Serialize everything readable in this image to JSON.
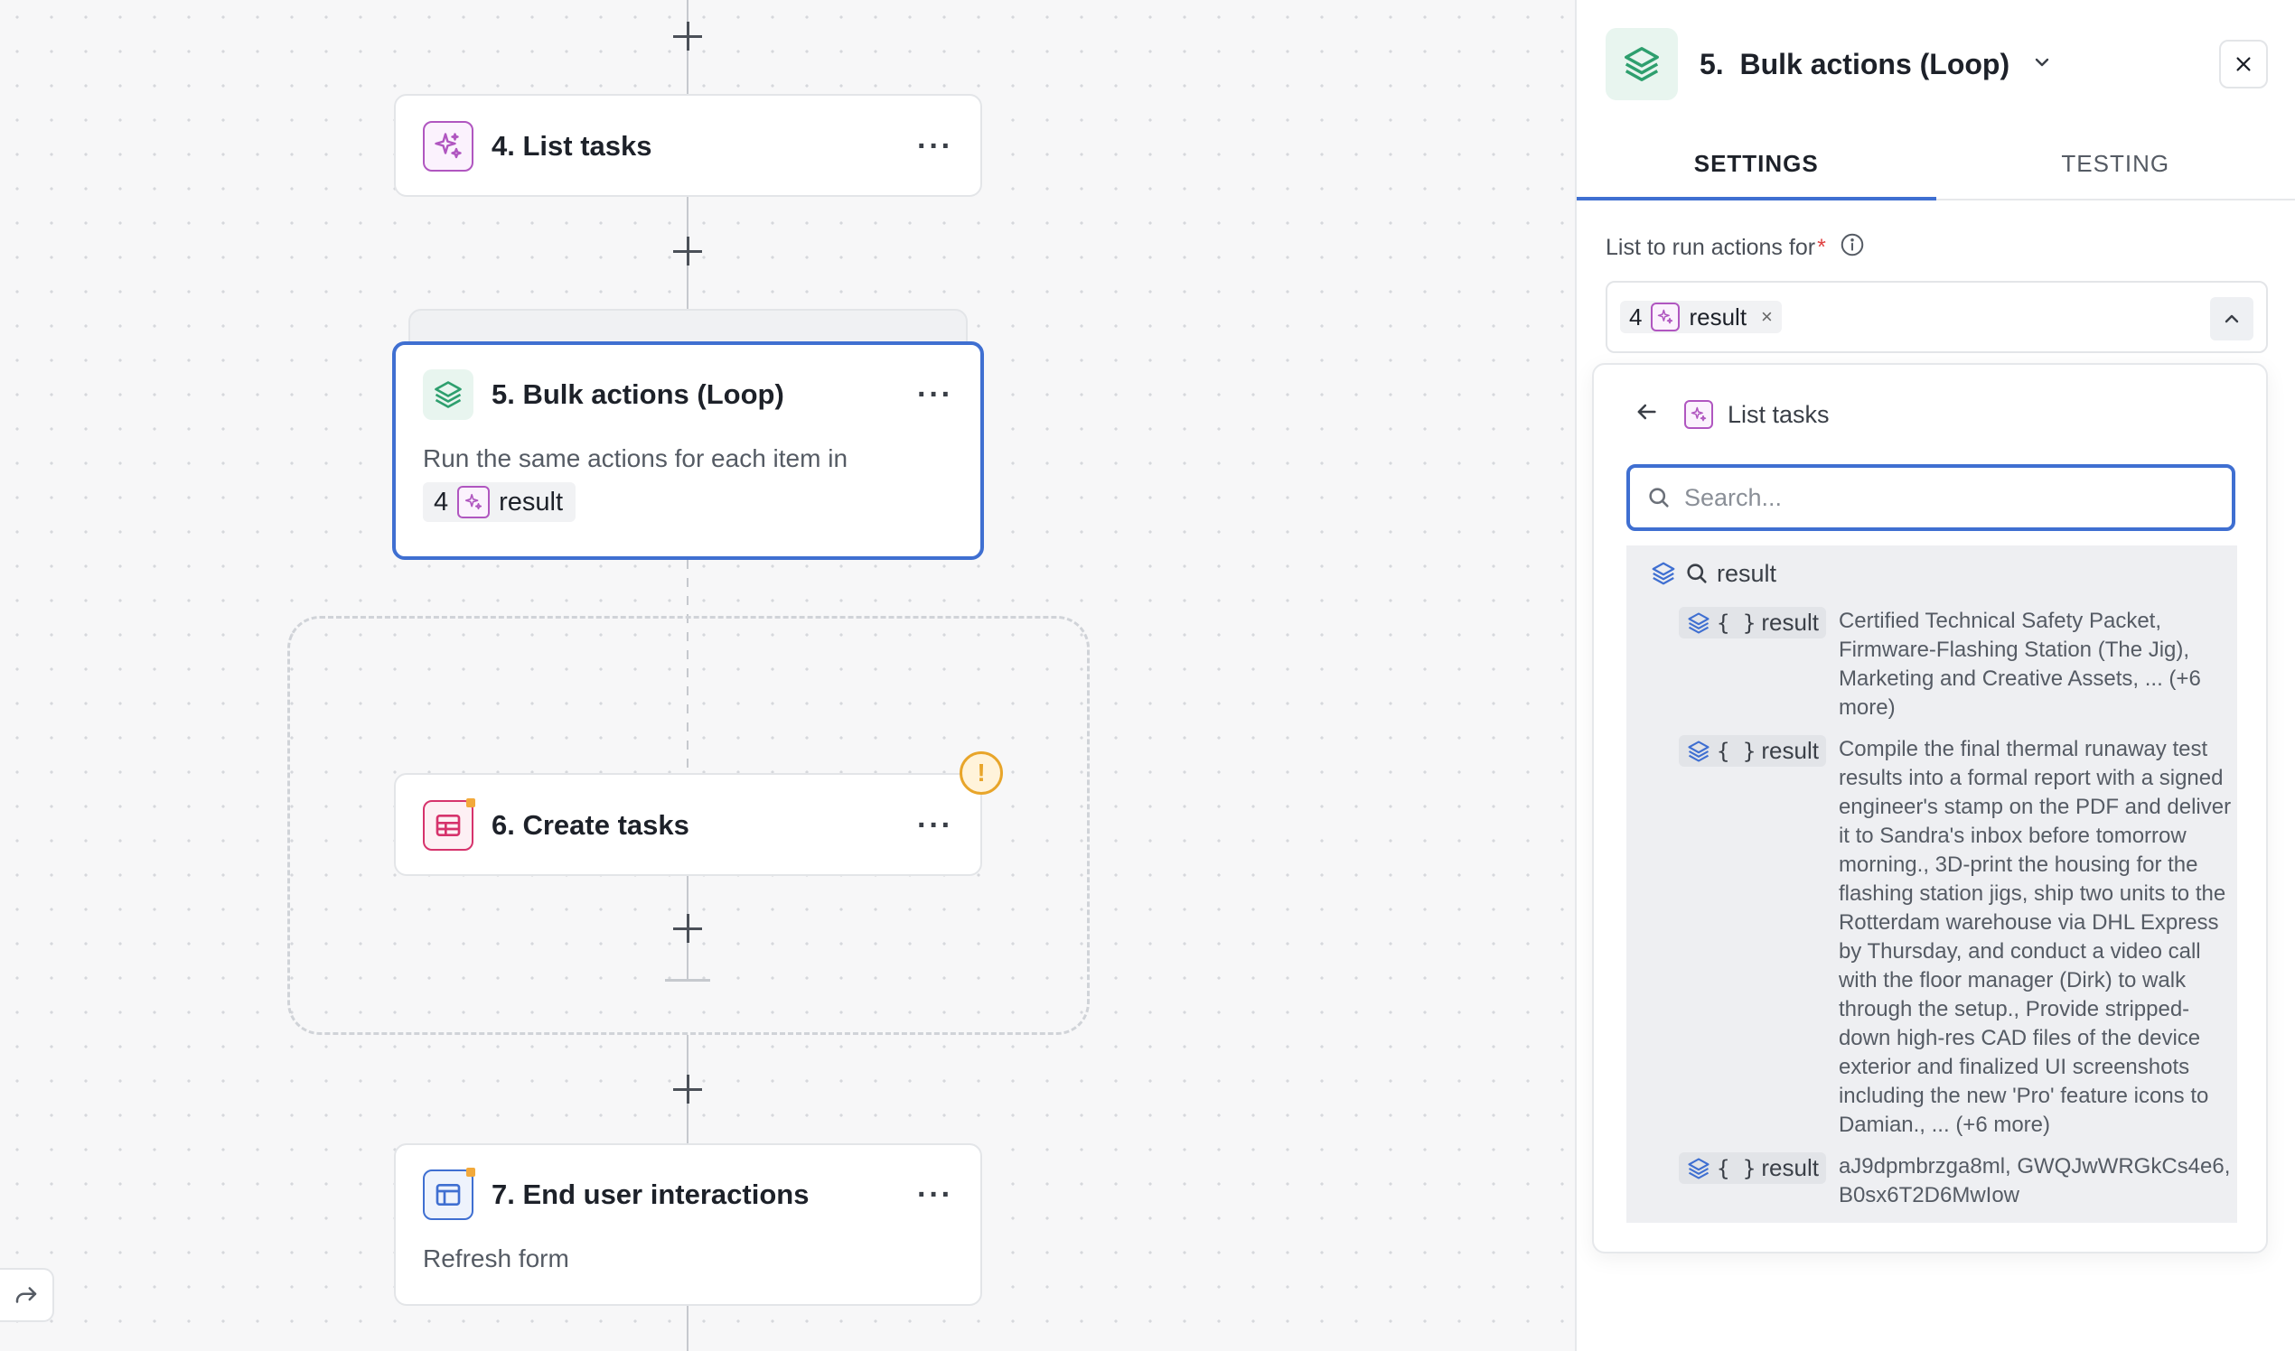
{
  "canvas": {
    "nodes": [
      {
        "id": "list-tasks",
        "title": "4. List tasks",
        "menu": "···"
      },
      {
        "id": "bulk-actions",
        "title": "5. Bulk actions (Loop)",
        "menu": "···",
        "description": "Run the same actions for each item in",
        "pill_number": "4",
        "pill_label": "result"
      },
      {
        "id": "create-tasks",
        "title": "6. Create tasks",
        "menu": "···",
        "warning": "!"
      },
      {
        "id": "end-user-interactions",
        "title": "7. End user interactions",
        "menu": "···",
        "description": "Refresh form"
      }
    ]
  },
  "panel": {
    "title": "5.  Bulk actions (Loop)",
    "tabs": [
      {
        "label": "SETTINGS"
      },
      {
        "label": "TESTING"
      }
    ],
    "field_label": "List to run actions for",
    "required_mark": "*",
    "selected": {
      "number": "4",
      "label": "result",
      "remove": "×"
    },
    "dropdown": {
      "breadcrumb": "List tasks",
      "search_placeholder": "Search...",
      "root_label": "result",
      "items": [
        {
          "key": "result",
          "value": "Certified Technical Safety Packet, Firmware-Flashing Station (The Jig), Marketing and Creative Assets, ... (+6 more)"
        },
        {
          "key": "result",
          "value": "Compile the final thermal runaway test results into a formal report with a signed engineer's stamp on the PDF and deliver it to Sandra's inbox before tomorrow morning., 3D-print the housing for the flashing station jigs, ship two units to the Rotterdam warehouse via DHL Express by Thursday, and conduct a video call with the floor manager (Dirk) to walk through the setup., Provide stripped-down high-res CAD files of the device exterior and finalized UI screenshots including the new 'Pro' feature icons to Damian., ... (+6 more)"
        },
        {
          "key": "result",
          "value": "aJ9dpmbrzga8ml, GWQJwWRGkCs4e6, B0sx6T2D6MwIow"
        }
      ]
    }
  },
  "colors": {
    "accent": "#3f6fd1",
    "loop_green": "#2e9f6e",
    "ai_purple": "#b056c0",
    "table_pink": "#d6336c",
    "warning": "#e8a52a"
  }
}
